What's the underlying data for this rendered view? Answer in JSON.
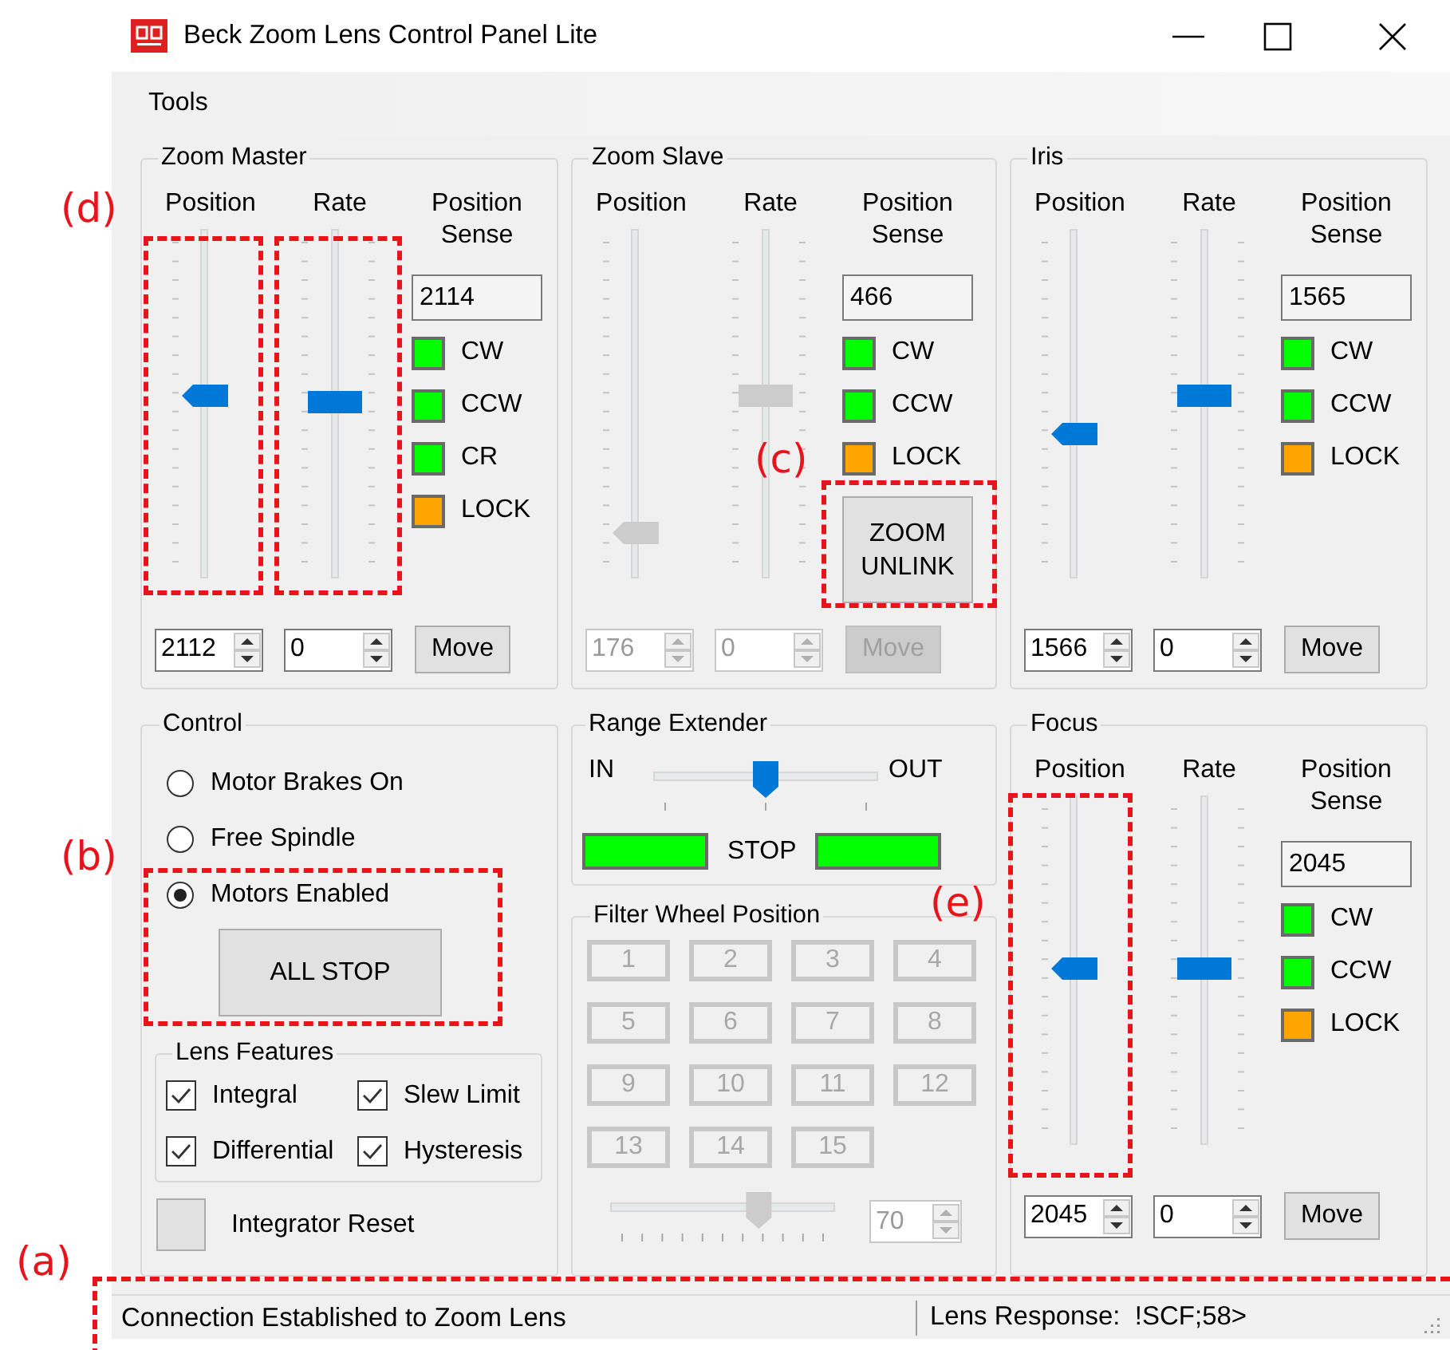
{
  "window": {
    "title": "Beck Zoom Lens Control Panel Lite"
  },
  "menu": [
    {
      "label": "Tools"
    }
  ],
  "axes": [
    {
      "title": "Zoom Master",
      "disabled": false,
      "position_label": "Position",
      "rate_label": "Rate",
      "sense_label": "Position Sense",
      "position_slider": {
        "level": 0.52
      },
      "rate_slider": {
        "level": 0.5
      },
      "sense_value": "2114",
      "indicators": [
        {
          "label": "CW",
          "color": "#00ff00"
        },
        {
          "label": "CCW",
          "color": "#00ff00"
        },
        {
          "label": "CR",
          "color": "#00ff00"
        },
        {
          "label": "LOCK",
          "color": "#ffa500"
        }
      ],
      "position_value": "2112",
      "rate_value": "0",
      "move_label": "Move"
    },
    {
      "title": "Zoom Slave",
      "disabled": true,
      "position_label": "Position",
      "rate_label": "Rate",
      "sense_label": "Position Sense",
      "position_slider": {
        "level": 0.09
      },
      "rate_slider": {
        "level": 0.52
      },
      "sense_value": "466",
      "indicators": [
        {
          "label": "CW",
          "color": "#00ff00"
        },
        {
          "label": "CCW",
          "color": "#00ff00"
        },
        {
          "label": "LOCK",
          "color": "#ffa500"
        }
      ],
      "position_value": "176",
      "rate_value": "0",
      "move_label": "Move",
      "unlink_label": "ZOOM UNLINK"
    },
    {
      "title": "Iris",
      "disabled": false,
      "position_label": "Position",
      "rate_label": "Rate",
      "sense_label": "Position Sense",
      "position_slider": {
        "level": 0.4
      },
      "rate_slider": {
        "level": 0.52
      },
      "sense_value": "1565",
      "indicators": [
        {
          "label": "CW",
          "color": "#00ff00"
        },
        {
          "label": "CCW",
          "color": "#00ff00"
        },
        {
          "label": "LOCK",
          "color": "#ffa500"
        }
      ],
      "position_value": "1566",
      "rate_value": "0",
      "move_label": "Move"
    },
    {
      "title": "Focus",
      "disabled": false,
      "position_label": "Position",
      "rate_label": "Rate",
      "sense_label": "Position Sense",
      "position_slider": {
        "level": 0.5
      },
      "rate_slider": {
        "level": 0.5
      },
      "sense_value": "2045",
      "indicators": [
        {
          "label": "CW",
          "color": "#00ff00"
        },
        {
          "label": "CCW",
          "color": "#00ff00"
        },
        {
          "label": "LOCK",
          "color": "#ffa500"
        }
      ],
      "position_value": "2045",
      "rate_value": "0",
      "move_label": "Move"
    }
  ],
  "control": {
    "title": "Control",
    "modes": [
      {
        "label": "Motor Brakes On",
        "selected": false
      },
      {
        "label": "Free Spindle",
        "selected": false
      },
      {
        "label": "Motors Enabled",
        "selected": true
      }
    ],
    "all_stop_label": "ALL STOP",
    "features": {
      "title": "Lens Features",
      "items": [
        {
          "label": "Integral",
          "checked": true
        },
        {
          "label": "Slew Limit",
          "checked": true
        },
        {
          "label": "Differential",
          "checked": true
        },
        {
          "label": "Hysteresis",
          "checked": true
        }
      ]
    },
    "integrator_reset_label": "Integrator Reset"
  },
  "range_extender": {
    "title": "Range Extender",
    "in_label": "IN",
    "out_label": "OUT",
    "level": 0.5,
    "stop_label": "STOP",
    "indicators": [
      {
        "color": "#00ff00"
      },
      {
        "color": "#00ff00"
      }
    ]
  },
  "filter_wheel": {
    "title": "Filter Wheel Position",
    "disabled": true,
    "buttons": [
      "1",
      "2",
      "3",
      "4",
      "5",
      "6",
      "7",
      "8",
      "9",
      "10",
      "11",
      "12",
      "13",
      "14",
      "15"
    ],
    "level": 0.68,
    "value": "70"
  },
  "status_bar": {
    "connection": "Connection Established to Zoom Lens",
    "response": "Lens Response:  !SCF;58>"
  },
  "annotations": [
    {
      "label": "(d)"
    },
    {
      "label": "(c)"
    },
    {
      "label": "(b)"
    },
    {
      "label": "(e)"
    },
    {
      "label": "(a)"
    }
  ]
}
